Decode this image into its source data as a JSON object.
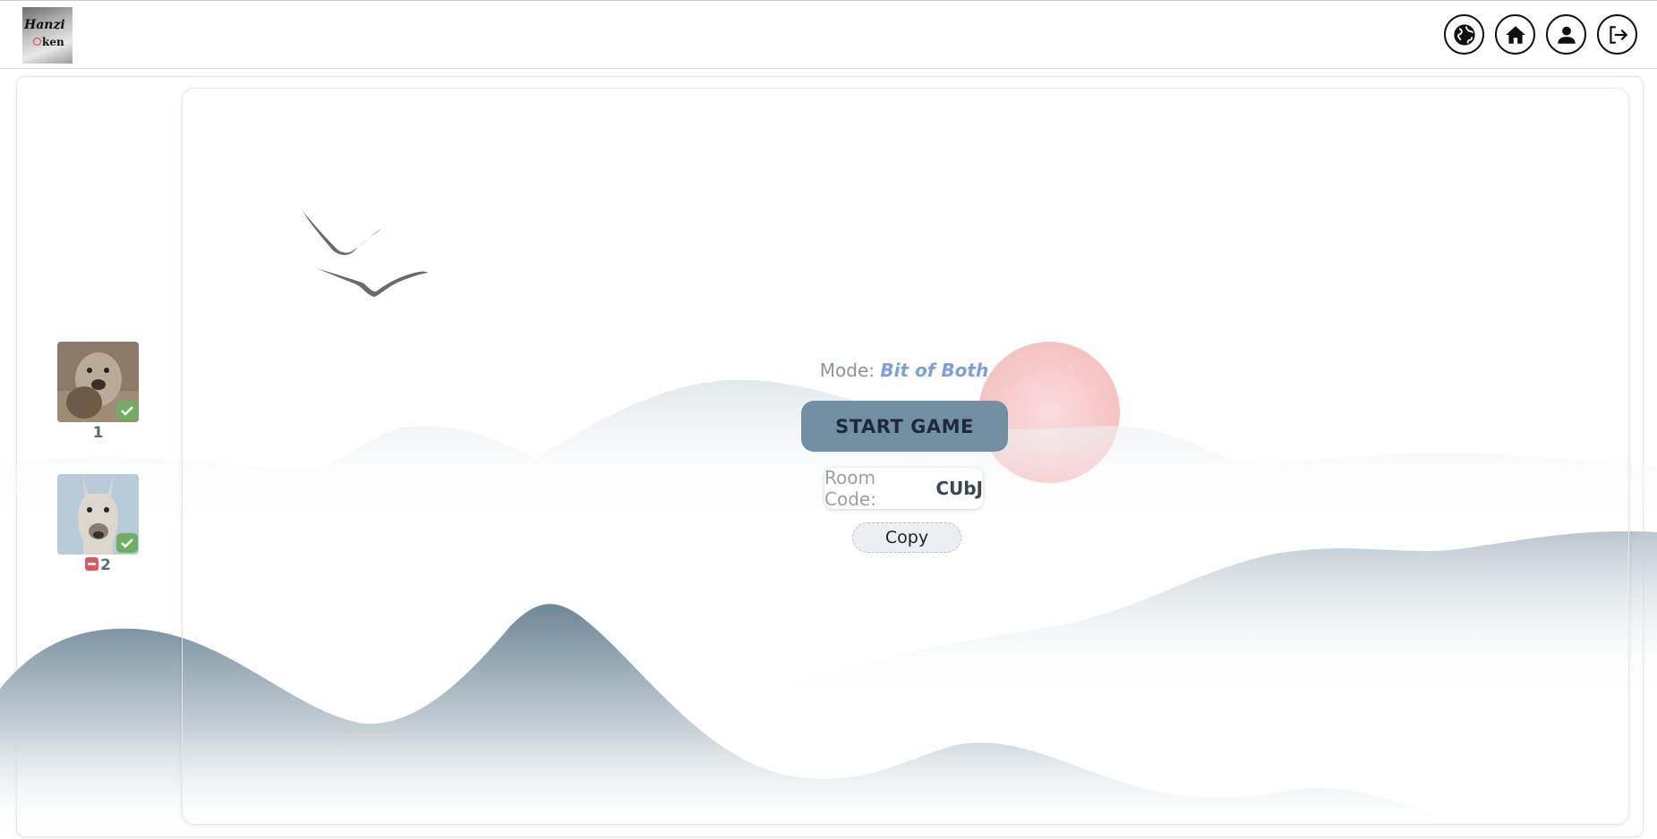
{
  "header": {
    "logo_text_top": "Hanzi",
    "logo_text_bottom": "ken",
    "nav_icons": [
      "globe-icon",
      "home-icon",
      "user-icon",
      "logout-icon"
    ]
  },
  "players": [
    {
      "number": "1",
      "avatar": "seal-avatar",
      "ready": true,
      "kickable": false
    },
    {
      "number": "2",
      "avatar": "llama-avatar",
      "ready": true,
      "kickable": true
    }
  ],
  "lobby": {
    "mode_label": "Mode:",
    "mode_value": "Bit of Both",
    "start_label": "START GAME",
    "room_code_label": "Room Code:",
    "room_code": "CUbJ",
    "copy_label": "Copy"
  },
  "colors": {
    "start_button": "#7190a4",
    "mode_value": "#7e9fd9",
    "ready_check": "#6fae63",
    "kick_button": "#e25560",
    "sun": "#f7c9c9"
  }
}
